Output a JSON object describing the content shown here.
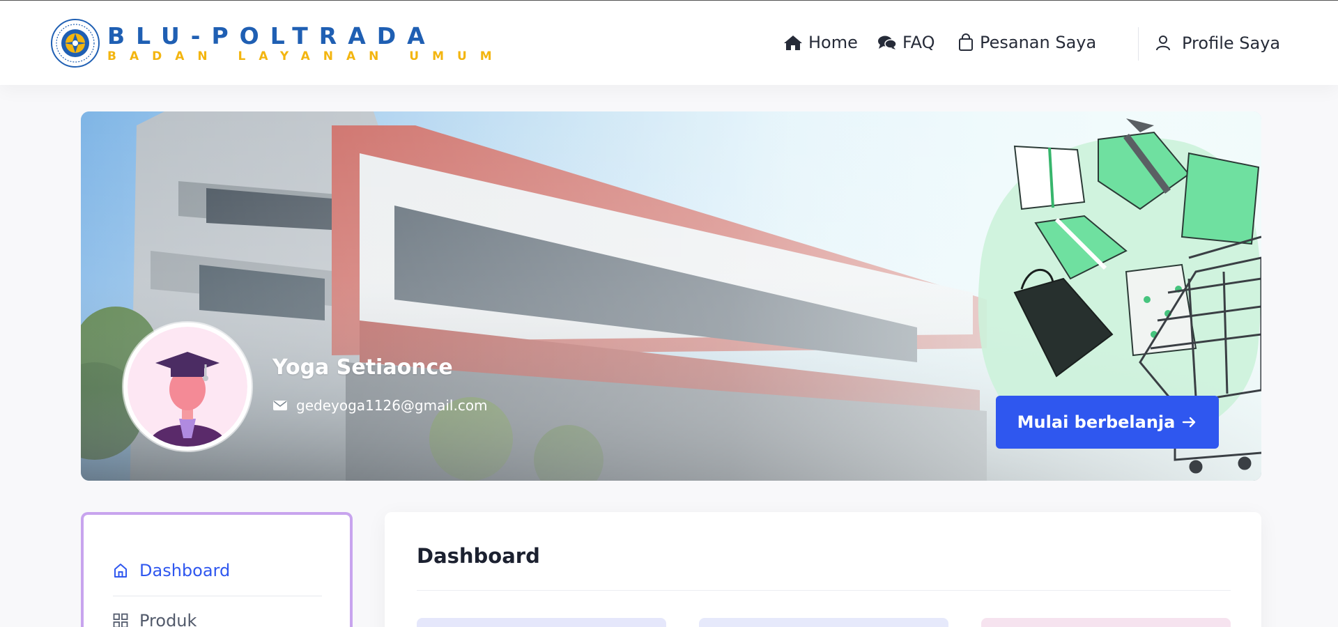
{
  "brand": {
    "title": "BLU-POLTRADA",
    "subtitle": "BADAN LAYANAN UMUM"
  },
  "nav": {
    "home": "Home",
    "faq": "FAQ",
    "orders": "Pesanan Saya",
    "profile": "Profile Saya"
  },
  "profile": {
    "name": "Yoga Setiaonce",
    "email": "gedeyoga1126@gmail.com"
  },
  "banner": {
    "cta": "Mulai berbelanja"
  },
  "sidebar": {
    "items": [
      {
        "label": "Dashboard",
        "icon": "home-outline-icon",
        "active": true
      },
      {
        "label": "Produk",
        "icon": "grid-icon",
        "active": false
      }
    ]
  },
  "main": {
    "title": "Dashboard"
  },
  "colors": {
    "brand_blue": "#1f5fb3",
    "brand_yellow": "#f3b50f",
    "accent": "#2f57ef",
    "sidebar_border": "#c8a4ee"
  }
}
